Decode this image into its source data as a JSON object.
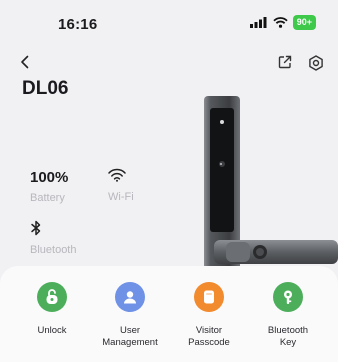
{
  "status_bar": {
    "time": "16:16",
    "battery": "90+"
  },
  "header": {
    "back_icon": "chevron-left-icon",
    "share_icon": "share-out-icon",
    "settings_icon": "gear-icon"
  },
  "device": {
    "name": "DL06"
  },
  "stats": {
    "battery_value": "100%",
    "battery_label": "Battery",
    "wifi_label": "Wi-Fi",
    "bluetooth_label": "Bluetooth"
  },
  "actions": [
    {
      "label": "Unlock",
      "color": "#4cae5b",
      "icon": "unlock-icon"
    },
    {
      "label": "User\nManagement",
      "color": "#6f92e6",
      "icon": "user-icon"
    },
    {
      "label": "Visitor\nPasscode",
      "color": "#f28a2e",
      "icon": "passcode-icon"
    },
    {
      "label": "Bluetooth\nKey",
      "color": "#4cae5b",
      "icon": "key-icon"
    }
  ]
}
